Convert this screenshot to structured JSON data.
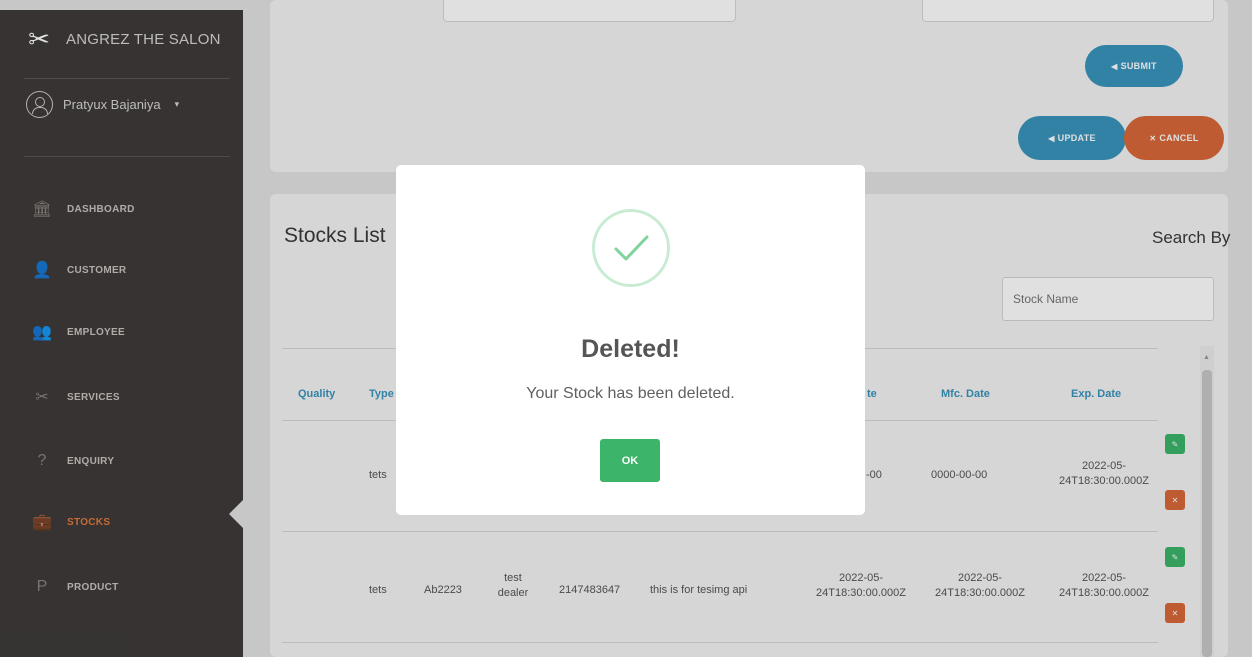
{
  "sidebar": {
    "brand": "ANGREZ THE SALON",
    "brand_icon": "scissors-icon",
    "user_name": "Pratyux Bajaniya",
    "user_caret": "▾",
    "items": [
      {
        "label": "DASHBOARD",
        "icon": "bank-icon",
        "glyph": "🏛"
      },
      {
        "label": "CUSTOMER",
        "icon": "user-icon",
        "glyph": "👤"
      },
      {
        "label": "EMPLOYEE",
        "icon": "group-icon",
        "glyph": "👥"
      },
      {
        "label": "SERVICES",
        "icon": "scissors-icon",
        "glyph": "✂"
      },
      {
        "label": "ENQUIRY",
        "icon": "question-icon",
        "glyph": "?"
      },
      {
        "label": "STOCKS",
        "icon": "briefcase-icon",
        "glyph": "💼"
      },
      {
        "label": "PRODUCT",
        "icon": "product-icon",
        "glyph": "P"
      }
    ],
    "active_item": "STOCKS"
  },
  "form": {
    "submit_label": "SUBMIT",
    "update_label": "UPDATE",
    "cancel_label": "CANCEL",
    "send_glyph": "◀",
    "cancel_glyph": "✕"
  },
  "stocks": {
    "title": "Stocks List",
    "search_by": "Search By",
    "search_placeholder": "Stock Name",
    "headers": {
      "quality": "Quality",
      "type": "Type",
      "fragment": "te",
      "mfc": "Mfc. Date",
      "exp": "Exp. Date"
    },
    "row1": {
      "type": "tets",
      "partial_date": "-00",
      "mfc": "0000-00-00",
      "exp_line1": "2022-05-",
      "exp_line2": "24T18:30:00.000Z"
    },
    "row2": {
      "type": "tets",
      "code": "Ab2223",
      "dealer_line1": "test",
      "dealer_line2": "dealer",
      "number": "2147483647",
      "description": "this is for tesimg api",
      "date1_line1": "2022-05-",
      "date1_line2": "24T18:30:00.000Z",
      "mfc_line1": "2022-05-",
      "mfc_line2": "24T18:30:00.000Z",
      "exp_line1": "2022-05-",
      "exp_line2": "24T18:30:00.000Z"
    }
  },
  "modal": {
    "title": "Deleted!",
    "message": "Your Stock has been deleted.",
    "ok_label": "OK"
  },
  "colors": {
    "sidebar_bg": "#3e3b39",
    "accent_blue": "#3a95bd",
    "accent_orange": "#d9683a",
    "success_green": "#3cb56a"
  }
}
